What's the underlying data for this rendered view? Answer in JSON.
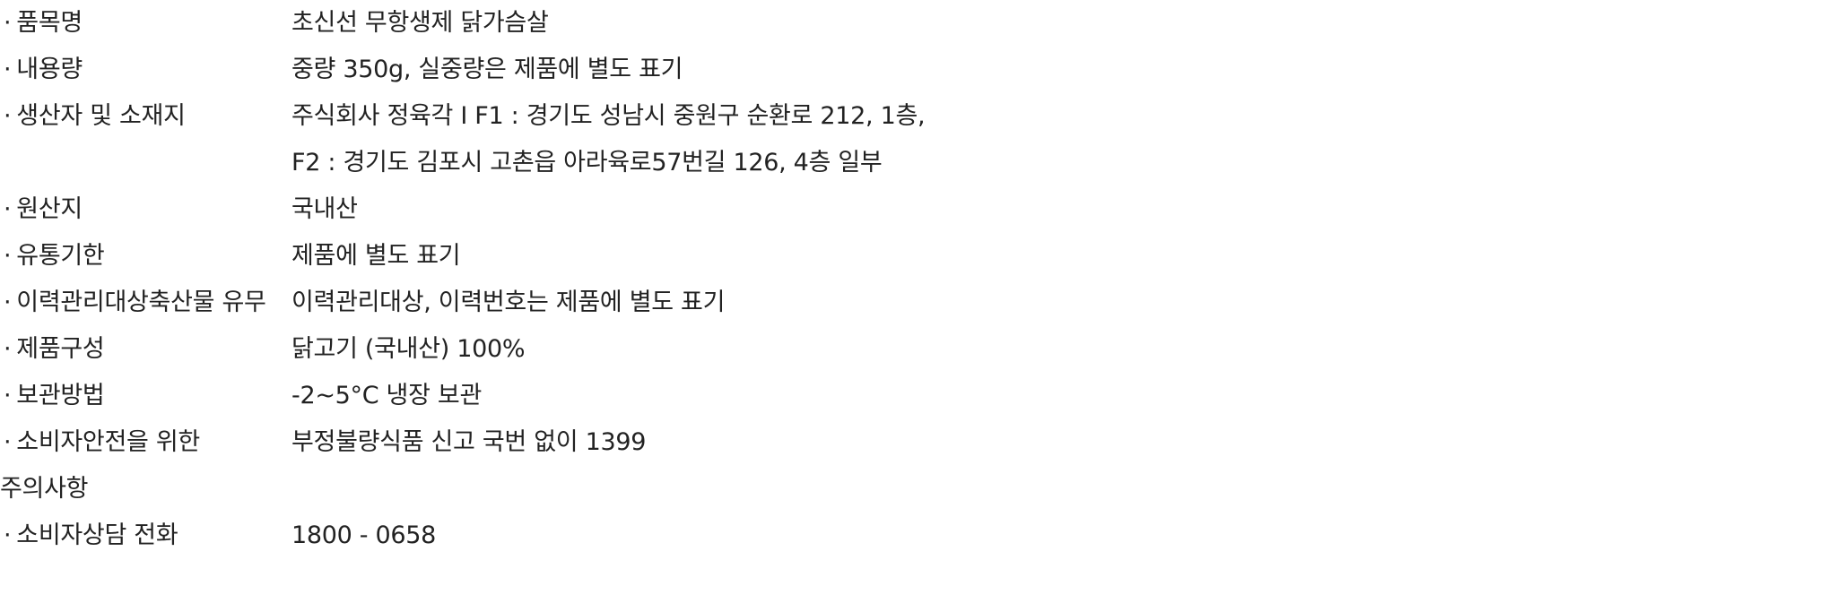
{
  "rows": [
    {
      "label": "품목명",
      "value": "초신선 무항생제 닭가슴살"
    },
    {
      "label": "내용량",
      "value": "중량 350g, 실중량은 제품에 별도 표기"
    },
    {
      "label": "생산자 및 소재지",
      "value": "주식회사 정육각 I F1 : 경기도 성남시 중원구 순환로 212, 1층,\nF2 : 경기도 김포시 고촌읍 아라육로57번길 126, 4층 일부"
    },
    {
      "label": "원산지",
      "value": "국내산"
    },
    {
      "label": "유통기한",
      "value": "제품에 별도 표기"
    },
    {
      "label": "이력관리대상축산물 유무",
      "value": "이력관리대상, 이력번호는 제품에 별도 표기"
    },
    {
      "label": "제품구성",
      "value": "닭고기 (국내산) 100%"
    },
    {
      "label": "보관방법",
      "value": "-2~5°C 냉장 보관"
    },
    {
      "label": "소비자안전을 위한 주의사항",
      "value": "부정불량식품 신고 국번 없이 1399"
    },
    {
      "label": "소비자상담 전화",
      "value": "1800 - 0658"
    }
  ],
  "bullet": "·"
}
